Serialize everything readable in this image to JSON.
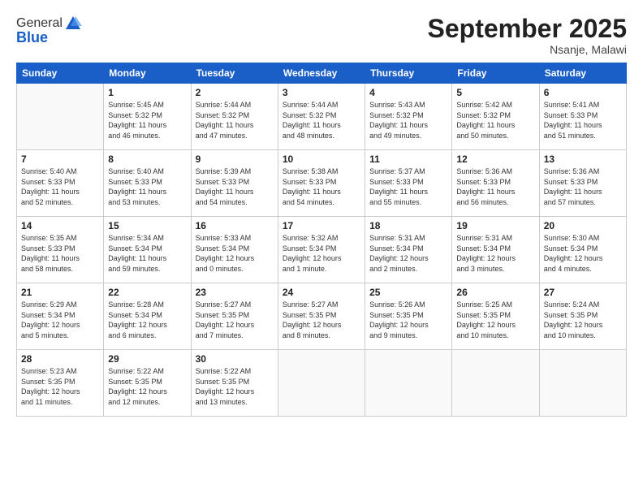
{
  "logo": {
    "general": "General",
    "blue": "Blue"
  },
  "header": {
    "month": "September 2025",
    "location": "Nsanje, Malawi"
  },
  "weekdays": [
    "Sunday",
    "Monday",
    "Tuesday",
    "Wednesday",
    "Thursday",
    "Friday",
    "Saturday"
  ],
  "weeks": [
    [
      {
        "day": "",
        "info": ""
      },
      {
        "day": "1",
        "info": "Sunrise: 5:45 AM\nSunset: 5:32 PM\nDaylight: 11 hours\nand 46 minutes."
      },
      {
        "day": "2",
        "info": "Sunrise: 5:44 AM\nSunset: 5:32 PM\nDaylight: 11 hours\nand 47 minutes."
      },
      {
        "day": "3",
        "info": "Sunrise: 5:44 AM\nSunset: 5:32 PM\nDaylight: 11 hours\nand 48 minutes."
      },
      {
        "day": "4",
        "info": "Sunrise: 5:43 AM\nSunset: 5:32 PM\nDaylight: 11 hours\nand 49 minutes."
      },
      {
        "day": "5",
        "info": "Sunrise: 5:42 AM\nSunset: 5:32 PM\nDaylight: 11 hours\nand 50 minutes."
      },
      {
        "day": "6",
        "info": "Sunrise: 5:41 AM\nSunset: 5:33 PM\nDaylight: 11 hours\nand 51 minutes."
      }
    ],
    [
      {
        "day": "7",
        "info": "Sunrise: 5:40 AM\nSunset: 5:33 PM\nDaylight: 11 hours\nand 52 minutes."
      },
      {
        "day": "8",
        "info": "Sunrise: 5:40 AM\nSunset: 5:33 PM\nDaylight: 11 hours\nand 53 minutes."
      },
      {
        "day": "9",
        "info": "Sunrise: 5:39 AM\nSunset: 5:33 PM\nDaylight: 11 hours\nand 54 minutes."
      },
      {
        "day": "10",
        "info": "Sunrise: 5:38 AM\nSunset: 5:33 PM\nDaylight: 11 hours\nand 54 minutes."
      },
      {
        "day": "11",
        "info": "Sunrise: 5:37 AM\nSunset: 5:33 PM\nDaylight: 11 hours\nand 55 minutes."
      },
      {
        "day": "12",
        "info": "Sunrise: 5:36 AM\nSunset: 5:33 PM\nDaylight: 11 hours\nand 56 minutes."
      },
      {
        "day": "13",
        "info": "Sunrise: 5:36 AM\nSunset: 5:33 PM\nDaylight: 11 hours\nand 57 minutes."
      }
    ],
    [
      {
        "day": "14",
        "info": "Sunrise: 5:35 AM\nSunset: 5:33 PM\nDaylight: 11 hours\nand 58 minutes."
      },
      {
        "day": "15",
        "info": "Sunrise: 5:34 AM\nSunset: 5:34 PM\nDaylight: 11 hours\nand 59 minutes."
      },
      {
        "day": "16",
        "info": "Sunrise: 5:33 AM\nSunset: 5:34 PM\nDaylight: 12 hours\nand 0 minutes."
      },
      {
        "day": "17",
        "info": "Sunrise: 5:32 AM\nSunset: 5:34 PM\nDaylight: 12 hours\nand 1 minute."
      },
      {
        "day": "18",
        "info": "Sunrise: 5:31 AM\nSunset: 5:34 PM\nDaylight: 12 hours\nand 2 minutes."
      },
      {
        "day": "19",
        "info": "Sunrise: 5:31 AM\nSunset: 5:34 PM\nDaylight: 12 hours\nand 3 minutes."
      },
      {
        "day": "20",
        "info": "Sunrise: 5:30 AM\nSunset: 5:34 PM\nDaylight: 12 hours\nand 4 minutes."
      }
    ],
    [
      {
        "day": "21",
        "info": "Sunrise: 5:29 AM\nSunset: 5:34 PM\nDaylight: 12 hours\nand 5 minutes."
      },
      {
        "day": "22",
        "info": "Sunrise: 5:28 AM\nSunset: 5:34 PM\nDaylight: 12 hours\nand 6 minutes."
      },
      {
        "day": "23",
        "info": "Sunrise: 5:27 AM\nSunset: 5:35 PM\nDaylight: 12 hours\nand 7 minutes."
      },
      {
        "day": "24",
        "info": "Sunrise: 5:27 AM\nSunset: 5:35 PM\nDaylight: 12 hours\nand 8 minutes."
      },
      {
        "day": "25",
        "info": "Sunrise: 5:26 AM\nSunset: 5:35 PM\nDaylight: 12 hours\nand 9 minutes."
      },
      {
        "day": "26",
        "info": "Sunrise: 5:25 AM\nSunset: 5:35 PM\nDaylight: 12 hours\nand 10 minutes."
      },
      {
        "day": "27",
        "info": "Sunrise: 5:24 AM\nSunset: 5:35 PM\nDaylight: 12 hours\nand 10 minutes."
      }
    ],
    [
      {
        "day": "28",
        "info": "Sunrise: 5:23 AM\nSunset: 5:35 PM\nDaylight: 12 hours\nand 11 minutes."
      },
      {
        "day": "29",
        "info": "Sunrise: 5:22 AM\nSunset: 5:35 PM\nDaylight: 12 hours\nand 12 minutes."
      },
      {
        "day": "30",
        "info": "Sunrise: 5:22 AM\nSunset: 5:35 PM\nDaylight: 12 hours\nand 13 minutes."
      },
      {
        "day": "",
        "info": ""
      },
      {
        "day": "",
        "info": ""
      },
      {
        "day": "",
        "info": ""
      },
      {
        "day": "",
        "info": ""
      }
    ]
  ]
}
